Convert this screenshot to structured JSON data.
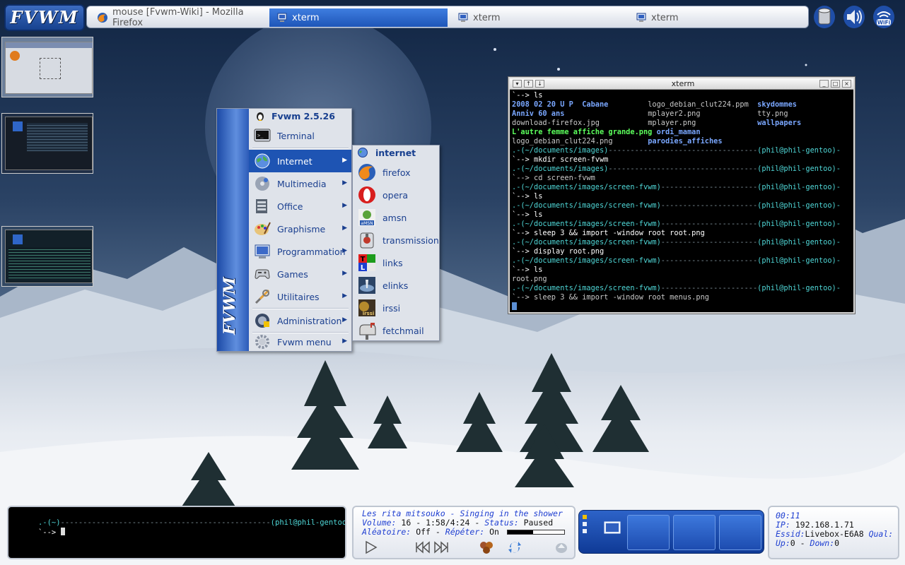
{
  "taskbar": {
    "logo": "FVWM",
    "tasks": [
      {
        "label": "mouse [Fvwm-Wiki] - Mozilla Firefox",
        "icon": "firefox-icon",
        "active": false
      },
      {
        "label": "xterm",
        "icon": "monitor-icon",
        "active": true
      },
      {
        "label": "xterm",
        "icon": "monitor-icon",
        "active": false
      },
      {
        "label": "xterm",
        "icon": "monitor-icon",
        "active": false
      }
    ],
    "tray": [
      "hard-drive-icon",
      "volume-icon",
      "wifi-icon"
    ],
    "tray_wifi_label": "WiFi"
  },
  "menu": {
    "title": "Fvwm 2.5.26",
    "sidebar_text": "FVWM",
    "items": [
      {
        "label": "Terminal",
        "icon": "terminal-icon",
        "submenu": false
      },
      {
        "label": "Internet",
        "icon": "globe-icon",
        "submenu": true,
        "selected": true
      },
      {
        "label": "Multimedia",
        "icon": "multimedia-icon",
        "submenu": true
      },
      {
        "label": "Office",
        "icon": "office-icon",
        "submenu": true
      },
      {
        "label": "Graphisme",
        "icon": "graphics-icon",
        "submenu": true
      },
      {
        "label": "Programmation",
        "icon": "programming-icon",
        "submenu": true
      },
      {
        "label": "Games",
        "icon": "gamepad-icon",
        "submenu": true
      },
      {
        "label": "Utilitaires",
        "icon": "tools-icon",
        "submenu": true
      },
      {
        "label": "Administration",
        "icon": "admin-icon",
        "submenu": true
      },
      {
        "label": "Fvwm menu",
        "icon": "gear-icon",
        "submenu": true
      }
    ]
  },
  "submenu": {
    "title": "internet",
    "items": [
      {
        "label": "firefox",
        "icon": "firefox-icon"
      },
      {
        "label": "opera",
        "icon": "opera-icon"
      },
      {
        "label": "amsn",
        "icon": "amsn-icon"
      },
      {
        "label": "transmission",
        "icon": "transmission-icon"
      },
      {
        "label": "links",
        "icon": "links-icon"
      },
      {
        "label": "elinks",
        "icon": "elinks-icon"
      },
      {
        "label": "irssi",
        "icon": "irssi-icon"
      },
      {
        "label": "fetchmail",
        "icon": "mailbox-icon"
      }
    ]
  },
  "xterm": {
    "title": "xterm",
    "lines": [
      [
        {
          "t": "`--> ls",
          "c": "c-white"
        }
      ],
      [
        {
          "t": "2008 02 20 U P  Cabane         ",
          "c": "c-blue"
        },
        {
          "t": "logo_debian_clut224.ppm  ",
          "c": "c-gray"
        },
        {
          "t": "skydommes",
          "c": "c-blue"
        }
      ],
      [
        {
          "t": "Anniv 60 ans                   ",
          "c": "c-blue"
        },
        {
          "t": "mplayer2.png             ",
          "c": "c-gray"
        },
        {
          "t": "tty.png",
          "c": "c-gray"
        }
      ],
      [
        {
          "t": "download-firefox.jpg           ",
          "c": "c-gray"
        },
        {
          "t": "mplayer.png              ",
          "c": "c-gray"
        },
        {
          "t": "wallpapers",
          "c": "c-blue"
        }
      ],
      [
        {
          "t": "L'autre femme affiche grande.png ",
          "c": "c-green"
        },
        {
          "t": "ordi_maman",
          "c": "c-blue"
        }
      ],
      [
        {
          "t": "logo_debian_clut224.png        ",
          "c": "c-gray"
        },
        {
          "t": "parodies_affiches",
          "c": "c-blue"
        }
      ],
      [
        {
          "t": ".-(~/documents/images)",
          "c": "c-cyan"
        },
        {
          "t": "----------------------------------",
          "c": "c-dim"
        },
        {
          "t": "(phil@phil-gentoo)-",
          "c": "c-cyan"
        }
      ],
      [
        {
          "t": "`--> mkdir screen-fvwm",
          "c": "c-white"
        }
      ],
      [
        {
          "t": ".-(~/documents/images)",
          "c": "c-cyan"
        },
        {
          "t": "----------------------------------",
          "c": "c-dim"
        },
        {
          "t": "(phil@phil-gentoo)-",
          "c": "c-cyan"
        }
      ],
      [
        {
          "t": "`--> cd screen-fvwm",
          "c": "c-gray"
        }
      ],
      [
        {
          "t": ".-(~/documents/images/screen-fvwm)",
          "c": "c-cyan"
        },
        {
          "t": "----------------------",
          "c": "c-dim"
        },
        {
          "t": "(phil@phil-gentoo)-",
          "c": "c-cyan"
        }
      ],
      [
        {
          "t": "`--> ls",
          "c": "c-white"
        }
      ],
      [
        {
          "t": ".-(~/documents/images/screen-fvwm)",
          "c": "c-cyan"
        },
        {
          "t": "----------------------",
          "c": "c-dim"
        },
        {
          "t": "(phil@phil-gentoo)-",
          "c": "c-cyan"
        }
      ],
      [
        {
          "t": "`--> ls",
          "c": "c-white"
        }
      ],
      [
        {
          "t": ".-(~/documents/images/screen-fvwm)",
          "c": "c-cyan"
        },
        {
          "t": "----------------------",
          "c": "c-dim"
        },
        {
          "t": "(phil@phil-gentoo)-",
          "c": "c-cyan"
        }
      ],
      [
        {
          "t": "`--> sleep 3 && import -window root root.png",
          "c": "c-white"
        }
      ],
      [
        {
          "t": ".-(~/documents/images/screen-fvwm)",
          "c": "c-cyan"
        },
        {
          "t": "----------------------",
          "c": "c-dim"
        },
        {
          "t": "(phil@phil-gentoo)-",
          "c": "c-cyan"
        }
      ],
      [
        {
          "t": "`--> display root.png",
          "c": "c-white"
        }
      ],
      [
        {
          "t": ".-(~/documents/images/screen-fvwm)",
          "c": "c-cyan"
        },
        {
          "t": "----------------------",
          "c": "c-dim"
        },
        {
          "t": "(phil@phil-gentoo)-",
          "c": "c-cyan"
        }
      ],
      [
        {
          "t": "`--> ls",
          "c": "c-white"
        }
      ],
      [
        {
          "t": "root.png",
          "c": "c-gray"
        }
      ],
      [
        {
          "t": ".-(~/documents/images/screen-fvwm)",
          "c": "c-cyan"
        },
        {
          "t": "----------------------",
          "c": "c-dim"
        },
        {
          "t": "(phil@phil-gentoo)-",
          "c": "c-cyan"
        }
      ],
      [
        {
          "t": "`--> sleep 3 && import -window root menus.png",
          "c": "c-gray"
        }
      ]
    ]
  },
  "bottom_term": {
    "prompt_path": ".-(~)",
    "prompt_user": "(phil@phil-gentoo)-",
    "prompt_cmd": "`-->"
  },
  "mpd": {
    "song": "Les rita mitsouko - Singing in the shower",
    "volume_label": "Volume:",
    "volume_value": "16",
    "time": "1:58/4:24",
    "status_label": "Status:",
    "status_value": "Paused",
    "random_label": "Aléatoire:",
    "random_value": "Off",
    "repeat_label": "Répéter:",
    "repeat_value": "On",
    "progress": 0.45,
    "controls": [
      "play-icon",
      "previous-icon",
      "next-icon",
      "shuffle-icon",
      "repeat-icon",
      "eject-icon"
    ]
  },
  "sysinfo": {
    "time": "00:11",
    "ip_label": "IP:",
    "ip_value": "192.168.1.71",
    "essid_label": "Essid:",
    "essid_value": "Livebox-E6A8",
    "qual_label": "Qual:",
    "up_label": "Up:",
    "up_value": "0",
    "down_label": "Down:",
    "down_value": "0"
  },
  "pager": {
    "desks": 3,
    "dock_desks": 4
  },
  "colors": {
    "menu_accent": "#1e54b3",
    "menu_text": "#1a3f8f",
    "term_bg": "#000000",
    "prompt_cyan": "#4fd6d6",
    "dir_blue": "#7aa7ff"
  }
}
